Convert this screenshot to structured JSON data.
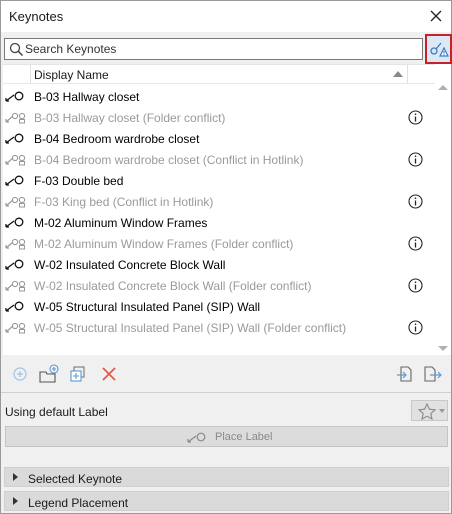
{
  "window": {
    "title": "Keynotes"
  },
  "search": {
    "placeholder": "Search Keynotes",
    "value": ""
  },
  "list": {
    "column_header": "Display Name",
    "rows": [
      {
        "label": "B-03 Hallway closet",
        "state": "active",
        "info": false
      },
      {
        "label": "B-03 Hallway closet (Folder conflict)",
        "state": "conflict",
        "info": true
      },
      {
        "label": "B-04 Bedroom wardrobe closet",
        "state": "active",
        "info": false
      },
      {
        "label": "B-04 Bedroom wardrobe closet (Conflict in Hotlink)",
        "state": "conflict",
        "info": true
      },
      {
        "label": "F-03 Double bed",
        "state": "active",
        "info": false
      },
      {
        "label": "F-03 King bed (Conflict in Hotlink)",
        "state": "conflict",
        "info": true
      },
      {
        "label": "M-02 Aluminum Window Frames",
        "state": "active",
        "info": false
      },
      {
        "label": "M-02 Aluminum Window Frames (Folder conflict)",
        "state": "conflict",
        "info": true
      },
      {
        "label": "W-02 Insulated Concrete Block Wall",
        "state": "active",
        "info": false
      },
      {
        "label": "W-02 Insulated Concrete Block Wall (Folder conflict)",
        "state": "conflict",
        "info": true
      },
      {
        "label": "W-05 Structural Insulated Panel (SIP) Wall",
        "state": "active",
        "info": false
      },
      {
        "label": "W-05 Structural Insulated Panel (SIP) Wall (Folder conflict)",
        "state": "conflict",
        "info": true
      }
    ]
  },
  "toolbar": {
    "icons": [
      "add-keynote-icon",
      "new-folder-icon",
      "duplicate-icon",
      "delete-icon",
      "import-icon",
      "export-icon"
    ]
  },
  "label_settings": {
    "text": "Using default Label"
  },
  "place_label": {
    "label": "Place Label"
  },
  "sections": [
    {
      "label": "Selected Keynote"
    },
    {
      "label": "Legend Placement"
    }
  ],
  "colors": {
    "highlight_border": "#c8202a",
    "delete_red": "#e05a4a",
    "icon_blue": "#5a9bd5",
    "conflict_text": "#9a9a9a"
  }
}
